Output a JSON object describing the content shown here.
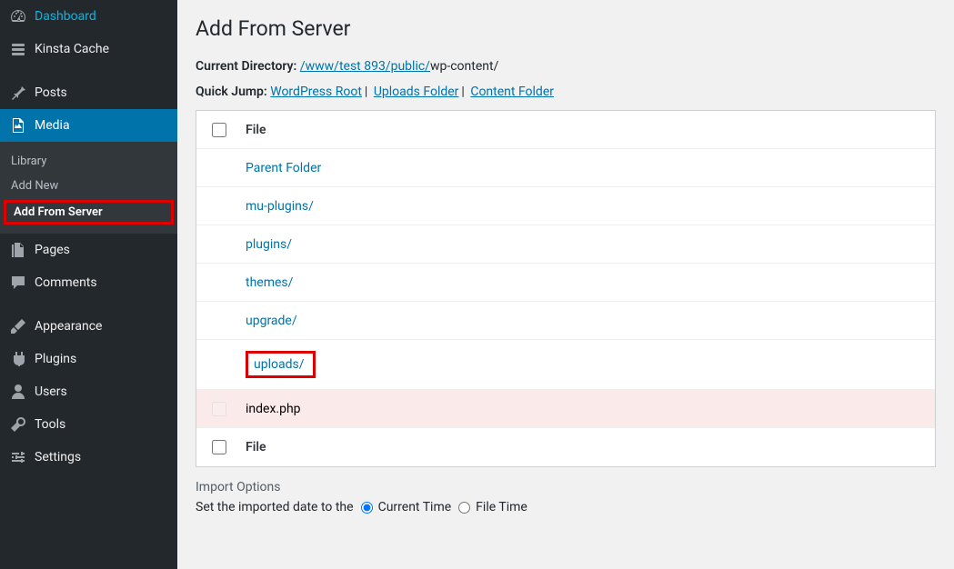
{
  "sidebar": {
    "items": [
      {
        "label": "Dashboard",
        "icon": "dashboard"
      },
      {
        "label": "Kinsta Cache",
        "icon": "kinsta"
      },
      {
        "label": "Posts",
        "icon": "pin"
      },
      {
        "label": "Media",
        "icon": "media",
        "current": true
      },
      {
        "label": "Pages",
        "icon": "page"
      },
      {
        "label": "Comments",
        "icon": "comment"
      },
      {
        "label": "Appearance",
        "icon": "brush"
      },
      {
        "label": "Plugins",
        "icon": "plug"
      },
      {
        "label": "Users",
        "icon": "user"
      },
      {
        "label": "Tools",
        "icon": "wrench"
      },
      {
        "label": "Settings",
        "icon": "sliders"
      }
    ],
    "submenu": {
      "library": "Library",
      "add_new": "Add New",
      "add_from_server": "Add From Server"
    }
  },
  "page": {
    "title": "Add From Server",
    "current_dir_label": "Current Directory:",
    "current_dir_link": "/www/test 893/public/",
    "current_dir_tail": "wp-content/",
    "quick_jump_label": "Quick Jump:",
    "quick_jump": {
      "root": "WordPress Root",
      "uploads": "Uploads Folder",
      "content": "Content Folder"
    },
    "file_header": "File",
    "rows": {
      "parent": "Parent Folder",
      "mu_plugins": "mu-plugins/",
      "plugins": "plugins/",
      "themes": "themes/",
      "upgrade": "upgrade/",
      "uploads": "uploads/",
      "index_php": "index.php"
    },
    "import": {
      "title": "Import Options",
      "date_label": "Set the imported date to the",
      "current_time": "Current Time",
      "file_time": "File Time"
    }
  }
}
